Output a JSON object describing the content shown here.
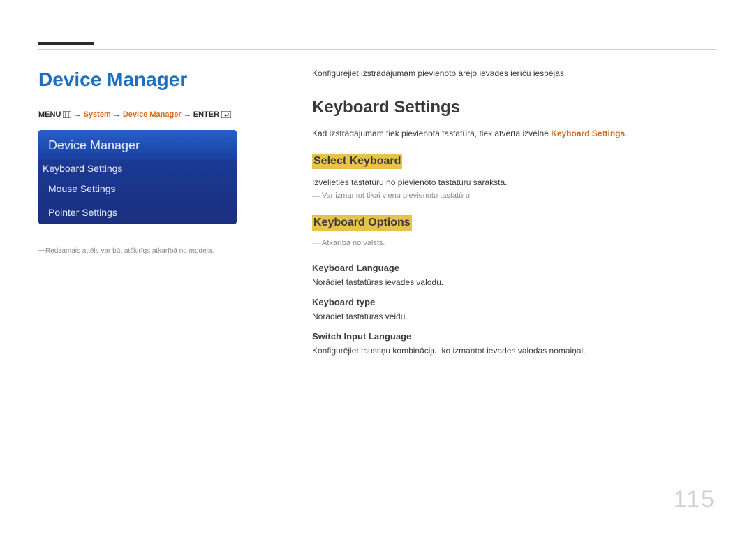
{
  "page_number": "115",
  "left": {
    "page_title": "Device Manager",
    "breadcrumb": {
      "menu_label": "MENU",
      "arrow": "→",
      "system": "System",
      "device_manager": "Device Manager",
      "enter_label": "ENTER"
    },
    "panel": {
      "header": "Device Manager",
      "items": [
        {
          "label": "Keyboard Settings",
          "selected": true
        },
        {
          "label": "Mouse Settings",
          "selected": false
        },
        {
          "label": "Pointer Settings",
          "selected": false
        }
      ]
    },
    "footnote": "Redzamais attēls var būt atšķirīgs atkarībā no modeļa."
  },
  "right": {
    "intro": "Konfigurējiet izstrādājumam pievienoto ārējo ievades ierīču iespējas.",
    "section_title": "Keyboard Settings",
    "section_p_pre": "Kad izstrādājumam tiek pievienota tastatūra, tiek atvērta izvēlne ",
    "section_p_kw": "Keyboard Settings",
    "section_p_post": ".",
    "select_keyboard": {
      "heading": "Select Keyboard",
      "desc": "Izvēlieties tastatūru no pievienoto tastatūru saraksta.",
      "note": "Var izmantot tikai vienu pievienoto tastatūru."
    },
    "keyboard_options": {
      "heading": "Keyboard Options",
      "note": "Atkarībā no valsts.",
      "items": [
        {
          "title": "Keyboard Language",
          "desc": "Norādiet tastatūras ievades valodu."
        },
        {
          "title": "Keyboard type",
          "desc": "Norādiet tastatūras veidu."
        },
        {
          "title": "Switch Input Language",
          "desc": "Konfigurējiet taustiņu kombināciju, ko izmantot ievades valodas nomaiņai."
        }
      ]
    }
  }
}
